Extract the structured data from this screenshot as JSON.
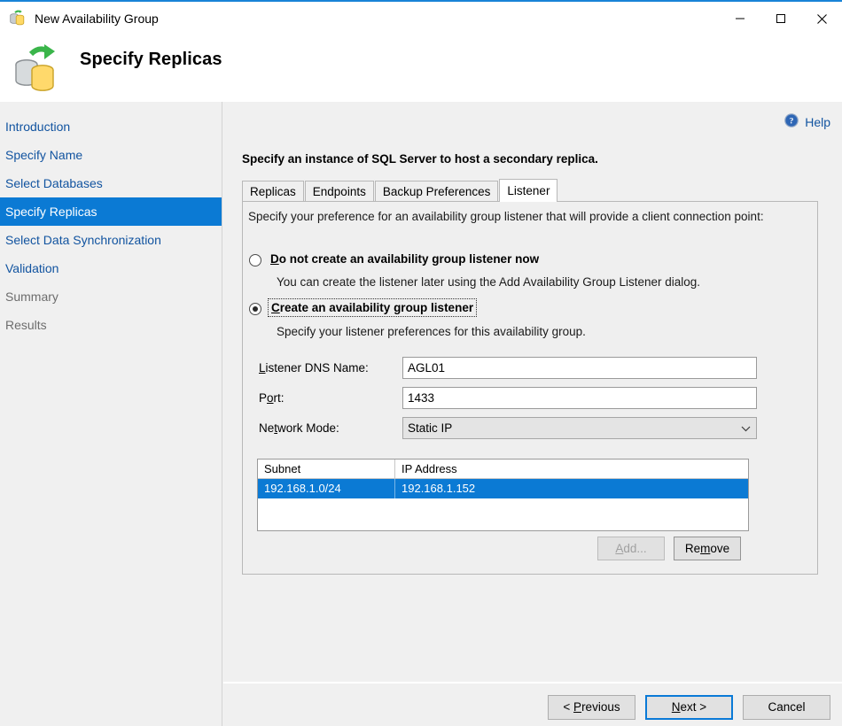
{
  "window": {
    "title": "New Availability Group",
    "icon": "availability-group-icon",
    "controls": {
      "minimize": "minimize-icon",
      "maximize": "maximize-icon",
      "close": "close-icon"
    }
  },
  "header": {
    "title": "Specify Replicas",
    "icon": "replica-sync-icon"
  },
  "sidebar": {
    "items": [
      {
        "label": "Introduction",
        "state": "link"
      },
      {
        "label": "Specify Name",
        "state": "link"
      },
      {
        "label": "Select Databases",
        "state": "link"
      },
      {
        "label": "Specify Replicas",
        "state": "selected"
      },
      {
        "label": "Select Data Synchronization",
        "state": "link"
      },
      {
        "label": "Validation",
        "state": "link"
      },
      {
        "label": "Summary",
        "state": "disabled"
      },
      {
        "label": "Results",
        "state": "disabled"
      }
    ]
  },
  "content": {
    "help": {
      "label": "Help",
      "icon": "help-circle-icon"
    },
    "instruction": "Specify an instance of SQL Server to host a secondary replica.",
    "tabs": [
      {
        "label": "Replicas",
        "active": false
      },
      {
        "label": "Endpoints",
        "active": false
      },
      {
        "label": "Backup Preferences",
        "active": false
      },
      {
        "label": "Listener",
        "active": true
      }
    ],
    "listener": {
      "preference_text": "Specify your preference for an availability group listener that will provide a client connection point:",
      "option_none": {
        "accel": "D",
        "label_rest": "o not create an availability group listener now",
        "description": "You can create the listener later using the Add Availability Group Listener dialog.",
        "checked": false
      },
      "option_create": {
        "accel": "C",
        "label_rest": "reate an availability group listener",
        "description": "Specify your listener preferences for this availability group.",
        "checked": true,
        "focused": true
      },
      "fields": {
        "dns_name": {
          "accel": "L",
          "label_rest": "istener DNS Name:",
          "value": "AGL01"
        },
        "port": {
          "label_pre": "P",
          "accel": "o",
          "label_rest": "rt:",
          "value": "1433"
        },
        "network_mode": {
          "label_pre": "Ne",
          "accel": "t",
          "label_rest": "work Mode:",
          "value": "Static IP",
          "arrow": "chevron-down-icon"
        }
      },
      "grid": {
        "columns": [
          "Subnet",
          "IP Address"
        ],
        "rows": [
          {
            "subnet": "192.168.1.0/24",
            "ip_address": "192.168.1.152",
            "selected": true
          }
        ]
      },
      "grid_buttons": {
        "add": {
          "label": "Add...",
          "accel": "A",
          "enabled": false
        },
        "remove": {
          "label_pre": "Re",
          "accel": "m",
          "label_rest": "ove",
          "enabled": true
        }
      }
    }
  },
  "footer": {
    "previous": {
      "label_pre": "< ",
      "accel": "P",
      "label_rest": "revious"
    },
    "next": {
      "accel": "N",
      "label_rest": "ext >",
      "default": true
    },
    "cancel": {
      "label": "Cancel"
    }
  }
}
